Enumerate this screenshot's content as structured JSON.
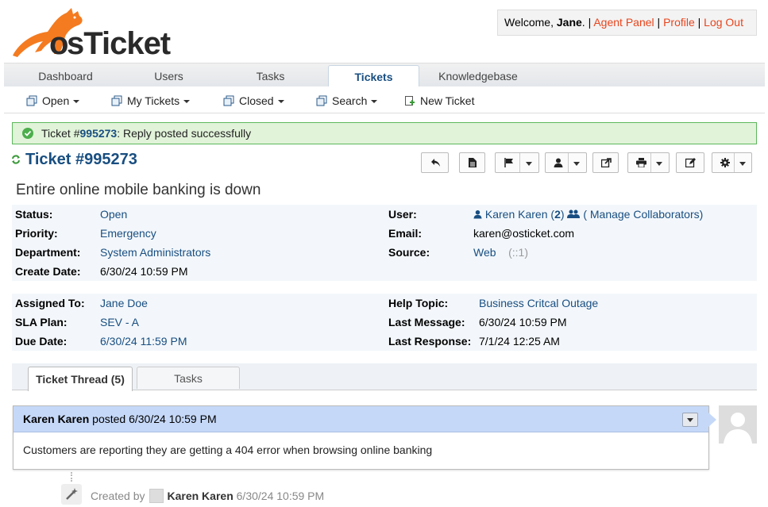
{
  "header": {
    "logo_text": "osTicket",
    "welcome_prefix": "Welcome, ",
    "welcome_user": "Jane",
    "welcome_suffix": ". |",
    "agent_panel": "Agent Panel",
    "profile": "Profile",
    "logout": "Log Out",
    "sep": "|"
  },
  "nav": {
    "tabs": [
      {
        "label": "Dashboard"
      },
      {
        "label": "Users"
      },
      {
        "label": "Tasks"
      },
      {
        "label": "Tickets"
      },
      {
        "label": "Knowledgebase"
      }
    ],
    "active": "Tickets"
  },
  "subnav": {
    "items": [
      {
        "label": "Open",
        "icon": "tickets-icon"
      },
      {
        "label": "My Tickets",
        "icon": "tickets-icon"
      },
      {
        "label": "Closed",
        "icon": "tickets-icon"
      },
      {
        "label": "Search",
        "icon": "tickets-icon"
      },
      {
        "label": "New Ticket",
        "icon": "new-ticket-icon"
      }
    ]
  },
  "alert": {
    "prefix": "Ticket #",
    "number": "995273",
    "message": ": Reply posted successfully"
  },
  "ticket": {
    "title": "Ticket #995273",
    "subject": "Entire online mobile banking is down"
  },
  "info1": {
    "status_label": "Status:",
    "status": "Open",
    "priority_label": "Priority:",
    "priority": "Emergency",
    "department_label": "Department:",
    "department": "System Administrators",
    "create_label": "Create Date:",
    "create_date": "6/30/24 10:59 PM",
    "user_label": "User:",
    "user": "Karen Karen",
    "user_count_open": "(",
    "user_count": "2",
    "user_count_close": ")",
    "collab": "( Manage Collaborators)",
    "email_label": "Email:",
    "email": "karen@osticket.com",
    "source_label": "Source:",
    "source": "Web",
    "source_ip": "(::1)"
  },
  "info2": {
    "assigned_label": "Assigned To:",
    "assigned": "Jane Doe",
    "sla_label": "SLA Plan:",
    "sla": "SEV - A",
    "due_label": "Due Date:",
    "due": "6/30/24 11:59 PM",
    "topic_label": "Help Topic:",
    "topic": "Business Critcal Outage",
    "last_msg_label": "Last Message:",
    "last_msg": "6/30/24 10:59 PM",
    "last_resp_label": "Last Response:",
    "last_resp": "7/1/24 12:25 AM"
  },
  "thread_tabs": [
    {
      "label": "Ticket Thread (5)"
    },
    {
      "label": "Tasks"
    }
  ],
  "entry": {
    "author": "Karen Karen",
    "posted": " posted 6/30/24 10:59 PM",
    "body": "Customers are reporting they are getting a 404 error when browsing online banking"
  },
  "created": {
    "prefix": "Created by",
    "author": "Karen Karen",
    "date": "6/30/24 10:59 PM"
  },
  "colors": {
    "brand_orange": "#f47b20",
    "link": "#184e81",
    "alert_bg": "#e1f3d9",
    "entry_head": "#c5d8f8"
  }
}
